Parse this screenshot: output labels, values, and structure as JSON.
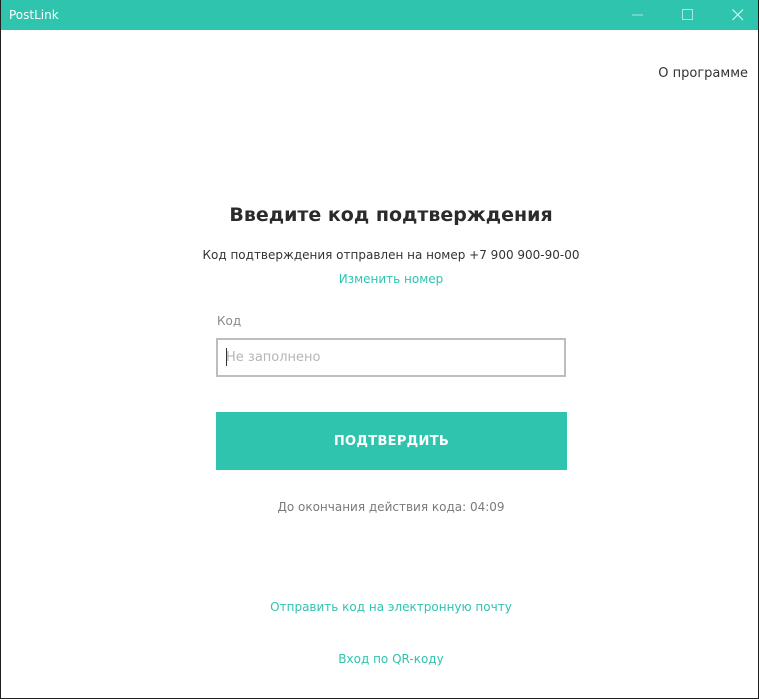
{
  "window": {
    "title": "PostLink",
    "accent_color": "#2ec4ae",
    "controls": {
      "minimize_icon": "minimize-icon",
      "maximize_icon": "maximize-icon",
      "close_icon": "close-icon"
    }
  },
  "header": {
    "about_label": "О программе"
  },
  "main": {
    "heading": "Введите код подтверждения",
    "subtext": "Код подтверждения отправлен на номер +7  900 900-90-00",
    "change_number_label": "Изменить номер",
    "code_field": {
      "label": "Код",
      "value": "",
      "placeholder": "Не заполнено"
    },
    "confirm_button_label": "ПОДТВЕРДИТЬ",
    "timer_text": "До окончания действия кода: 04:09",
    "email_link_label": "Отправить код на электронную почту",
    "qr_link_label": "Вход по QR-коду"
  }
}
